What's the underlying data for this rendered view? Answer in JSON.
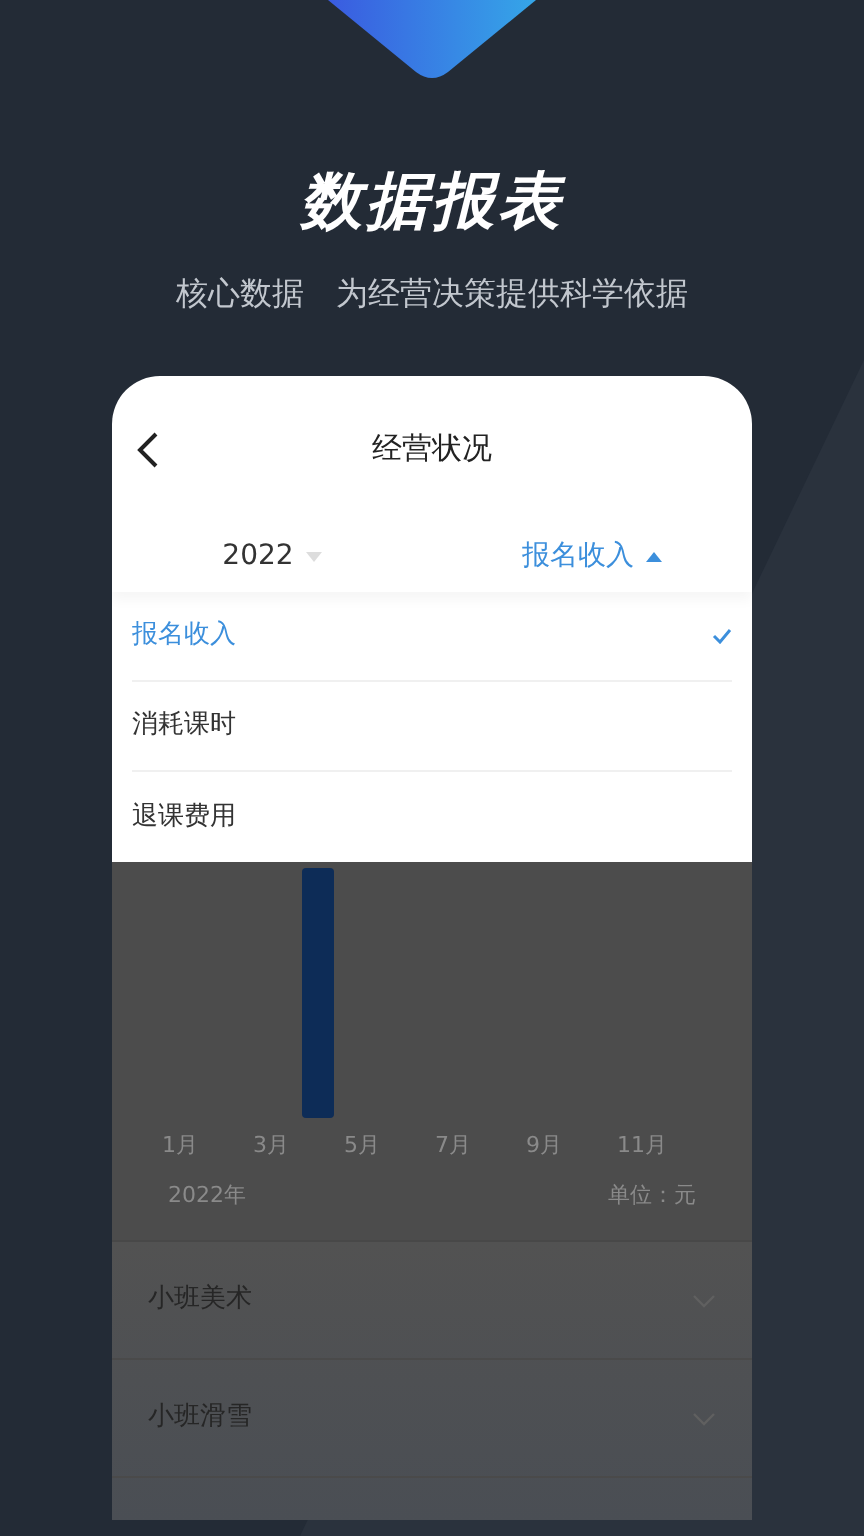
{
  "hero": {
    "title": "数据报表",
    "subtitle": [
      "核心数据",
      "为经营决策提供科学依据"
    ]
  },
  "screen": {
    "title": "经营状况",
    "filters": [
      {
        "label": "2022",
        "expanded": false
      },
      {
        "label": "报名收入",
        "expanded": true
      }
    ],
    "menu": [
      {
        "label": "报名收入",
        "selected": true
      },
      {
        "label": "消耗课时",
        "selected": false
      },
      {
        "label": "退课费用",
        "selected": false
      }
    ],
    "chart": {
      "x_labels": [
        "1月",
        "3月",
        "5月",
        "7月",
        "9月",
        "11月"
      ],
      "year": "2022年",
      "unit": "单位：元"
    },
    "list": [
      {
        "label": "小班美术",
        "expanded": false
      },
      {
        "label": "小班滑雪",
        "expanded": false
      }
    ]
  }
}
